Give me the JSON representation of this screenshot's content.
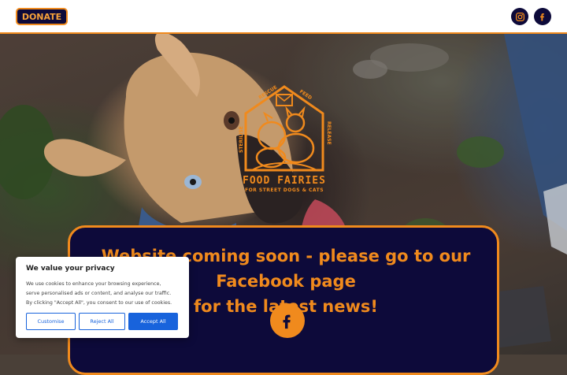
{
  "header": {
    "donate_label": "DONATE",
    "social": [
      {
        "name": "instagram-icon"
      },
      {
        "name": "facebook-icon"
      }
    ]
  },
  "logo": {
    "arc_words": [
      "RESCUE",
      "FEED",
      "STERILISE",
      "RELEASE"
    ],
    "title": "FOOD FAIRIES",
    "subtitle": "FOR STREET DOGS & CATS"
  },
  "banner": {
    "line1": "Website coming soon - please go to our Facebook page",
    "line2": "for the latest news!"
  },
  "cookie": {
    "title": "We value your privacy",
    "text": "We use cookies to enhance your browsing experience,\nserve personalised ads or content, and analyse our traffic.\nBy clicking \"Accept All\", you consent to our use of cookies.",
    "customise_label": "Customise",
    "reject_label": "Reject All",
    "accept_label": "Accept All"
  },
  "colors": {
    "navy": "#0d0a3a",
    "orange": "#f08a1d",
    "cookie_blue": "#1863dc"
  }
}
